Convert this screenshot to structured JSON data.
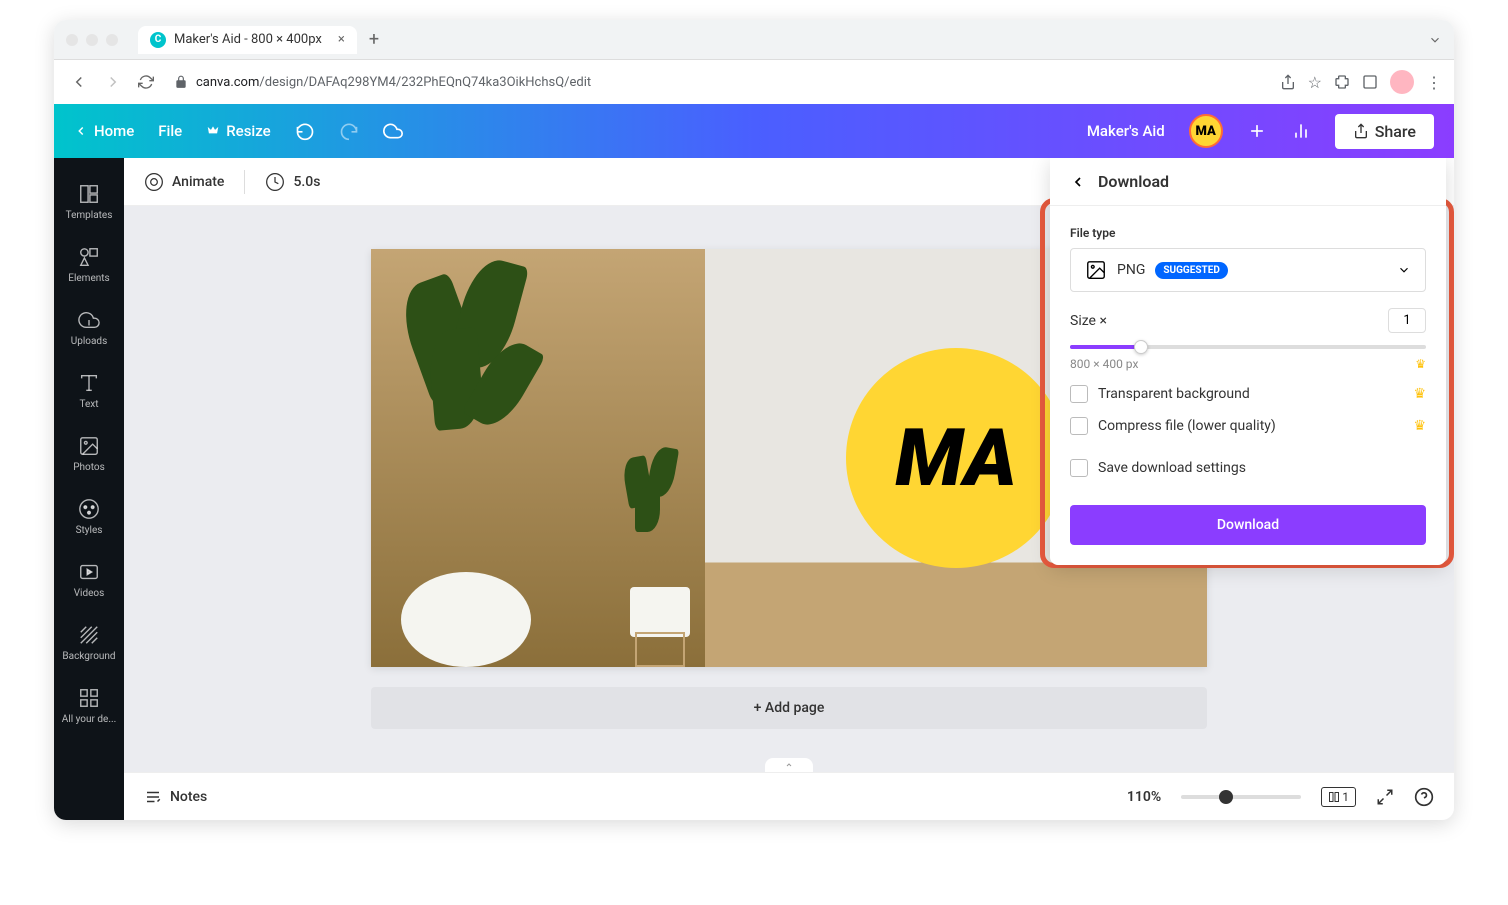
{
  "browser": {
    "tab_title": "Maker's Aid - 800 × 400px",
    "url_host": "canva.com",
    "url_path": "/design/DAFAq298YM4/232PhEQnQ74ka3OikHchsQ/edit"
  },
  "header": {
    "home": "Home",
    "file": "File",
    "resize": "Resize",
    "project_name": "Maker's Aid",
    "avatar_text": "MA",
    "share": "Share"
  },
  "sidebar": {
    "items": [
      {
        "label": "Templates"
      },
      {
        "label": "Elements"
      },
      {
        "label": "Uploads"
      },
      {
        "label": "Text"
      },
      {
        "label": "Photos"
      },
      {
        "label": "Styles"
      },
      {
        "label": "Videos"
      },
      {
        "label": "Background"
      },
      {
        "label": "All your de..."
      }
    ]
  },
  "toolbar": {
    "animate": "Animate",
    "duration": "5.0s"
  },
  "canvas": {
    "logo_text": "MA",
    "add_page": "+ Add page"
  },
  "download_panel": {
    "title": "Download",
    "file_type_label": "File type",
    "file_type_value": "PNG",
    "suggested_badge": "SUGGESTED",
    "size_label": "Size ×",
    "size_value": "1",
    "dimensions": "800 × 400 px",
    "transparent_bg": "Transparent background",
    "compress": "Compress file (lower quality)",
    "save_settings": "Save download settings",
    "download_btn": "Download"
  },
  "bottom_bar": {
    "notes": "Notes",
    "zoom": "110%",
    "page_count": "1"
  }
}
